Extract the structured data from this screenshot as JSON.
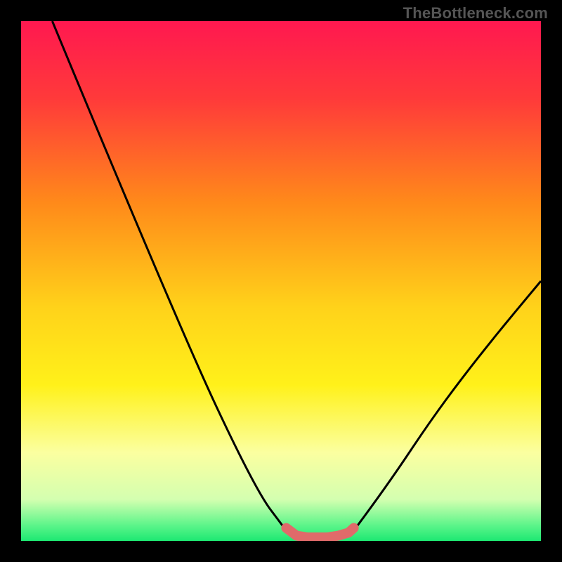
{
  "watermark": "TheBottleneck.com",
  "chart_data": {
    "type": "line",
    "title": "",
    "xlabel": "",
    "ylabel": "",
    "xlim": [
      0,
      100
    ],
    "ylim": [
      0,
      100
    ],
    "grid": false,
    "legend": false,
    "series": [
      {
        "name": "left-branch",
        "x": [
          6,
          30,
          45,
          51
        ],
        "y": [
          100,
          42,
          10,
          2
        ]
      },
      {
        "name": "right-branch",
        "x": [
          64,
          70,
          80,
          90,
          100
        ],
        "y": [
          2,
          10,
          25,
          38,
          50
        ]
      },
      {
        "name": "valley-marker",
        "x": [
          51,
          53,
          55,
          57,
          59,
          61,
          63,
          64
        ],
        "y": [
          2.5,
          1,
          0.7,
          0.7,
          0.7,
          1,
          1.6,
          2.5
        ]
      }
    ],
    "background_gradient": {
      "stops": [
        {
          "offset": 0.0,
          "color": "#ff1850"
        },
        {
          "offset": 0.15,
          "color": "#ff3a3a"
        },
        {
          "offset": 0.35,
          "color": "#ff8a1a"
        },
        {
          "offset": 0.55,
          "color": "#ffd21a"
        },
        {
          "offset": 0.7,
          "color": "#fff11a"
        },
        {
          "offset": 0.83,
          "color": "#fbffa0"
        },
        {
          "offset": 0.92,
          "color": "#d4ffb0"
        },
        {
          "offset": 0.97,
          "color": "#5cf58a"
        },
        {
          "offset": 1.0,
          "color": "#1de872"
        }
      ]
    },
    "curve_color": "#000000",
    "marker_color": "#e06a6a"
  }
}
